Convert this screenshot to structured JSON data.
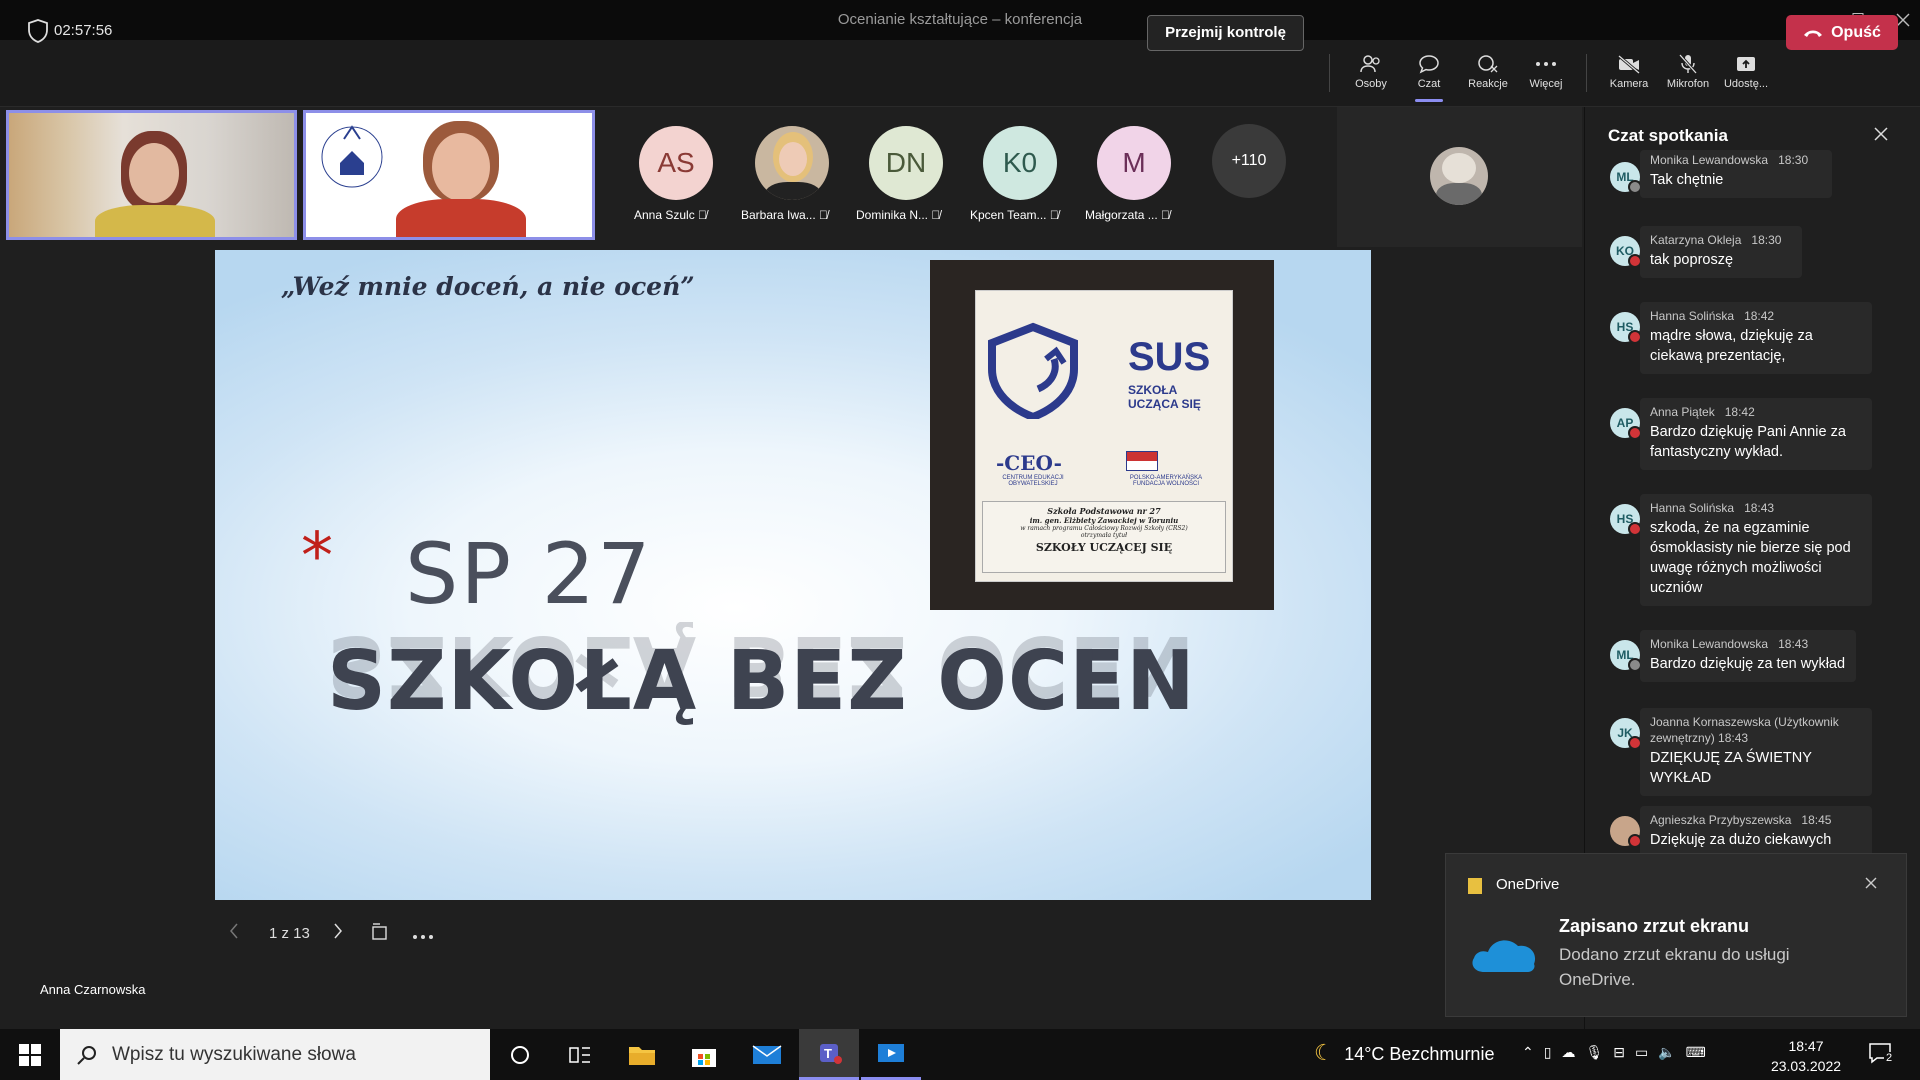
{
  "window": {
    "title": "Ocenianie kształtujące – konferencja"
  },
  "meeting": {
    "timer": "02:57:56",
    "take_control": "Przejmij kontrolę",
    "tools": [
      {
        "label": "Osoby",
        "icon": "people-icon"
      },
      {
        "label": "Czat",
        "icon": "chat-icon",
        "active": true
      },
      {
        "label": "Reakcje",
        "icon": "reactions-icon"
      },
      {
        "label": "Więcej",
        "icon": "more-icon"
      },
      {
        "label": "Kamera",
        "icon": "camera-off-icon"
      },
      {
        "label": "Mikrofon",
        "icon": "mic-off-icon"
      },
      {
        "label": "Udostę...",
        "icon": "share-icon"
      }
    ],
    "leave": "Opuść"
  },
  "participants": [
    {
      "initials": "AS",
      "name": "Anna Szulc",
      "color": "#f3d3d0",
      "text_color": "#8a3a35"
    },
    {
      "initials": "",
      "name": "Barbara Iwa...",
      "color": "#c9b7a0",
      "text_color": "#333"
    },
    {
      "initials": "DN",
      "name": "Dominika N...",
      "color": "#dfe8d3",
      "text_color": "#4a5a3a"
    },
    {
      "initials": "K0",
      "name": "Kpcen Team...",
      "color": "#cfe8e0",
      "text_color": "#2f5a4e"
    },
    {
      "initials": "M",
      "name": "Małgorzata ...",
      "color": "#f1d4e8",
      "text_color": "#6b2f58"
    }
  ],
  "more_participants": "+110",
  "slide": {
    "quote": "„Weź mnie doceń, a nie oceń”",
    "star": "*",
    "line1": "SP 27",
    "line2": "SZKOŁĄ BEZ OCEN",
    "plaque": {
      "logo_text": "SUS",
      "logo_sub1": "SZKOŁA",
      "logo_sub2": "UCZĄCA SIĘ",
      "ceo": "-CEO-",
      "ceo_sub": "CENTRUM EDUKACJI OBYWATELSKIEJ",
      "pafw": "POLSKO-AMERYKAŃSKA FUNDACJA WOLNOŚCI",
      "l1": "Szkoła Podstawowa nr 27",
      "l2": "im. gen. Elżbiety Zawackiej w Toruniu",
      "l3": "w ramach programu Całościowy Rozwój Szkoły (CRS2)",
      "l4": "otrzymała tytuł",
      "l5": "SZKOŁY UCZĄCEJ SIĘ"
    },
    "page": "1 z 13"
  },
  "presenter": "Anna Czarnowska",
  "chat": {
    "title": "Czat spotkania",
    "messages": [
      {
        "initials": "ML",
        "name": "Monika Lewandowska",
        "time": "18:30",
        "text": "Tak chętnie",
        "status": "gray"
      },
      {
        "initials": "KO",
        "name": "Katarzyna Okleja",
        "time": "18:30",
        "text": "tak poproszę",
        "status": "red"
      },
      {
        "initials": "HS",
        "name": "Hanna Solińska",
        "time": "18:42",
        "text": "mądre słowa, dziękuję za ciekawą prezentację,",
        "status": "red"
      },
      {
        "initials": "AP",
        "name": "Anna Piątek",
        "time": "18:42",
        "text": "Bardzo dziękuję Pani Annie za fantastyczny wykład.",
        "status": "red"
      },
      {
        "initials": "HS",
        "name": "Hanna Solińska",
        "time": "18:43",
        "text": "szkoda, że na egzaminie ósmoklasisty nie bierze się pod uwagę różnych możliwości uczniów",
        "status": "red"
      },
      {
        "initials": "ML",
        "name": "Monika Lewandowska",
        "time": "18:43",
        "text": "Bardzo dziękuję za ten wykład",
        "status": "gray"
      },
      {
        "initials": "JK",
        "name": "Joanna Kornaszewska (Użytkownik zewnętrzny)",
        "time": "18:43",
        "text": "DZIĘKUJĘ ZA ŚWIETNY WYKŁAD",
        "status": "red"
      },
      {
        "initials": "",
        "name": "Agnieszka Przybyszewska",
        "time": "18:45",
        "text": "Dziękuję za dużo ciekawych",
        "status": "red"
      }
    ]
  },
  "toast": {
    "app": "OneDrive",
    "title": "Zapisano zrzut ekranu",
    "body": "Dodano zrzut ekranu do usługi OneDrive."
  },
  "taskbar": {
    "search_placeholder": "Wpisz tu wyszukiwane słowa",
    "weather": "14°C  Bezchmurnie",
    "time": "18:47",
    "date": "23.03.2022",
    "notifications": "2"
  }
}
